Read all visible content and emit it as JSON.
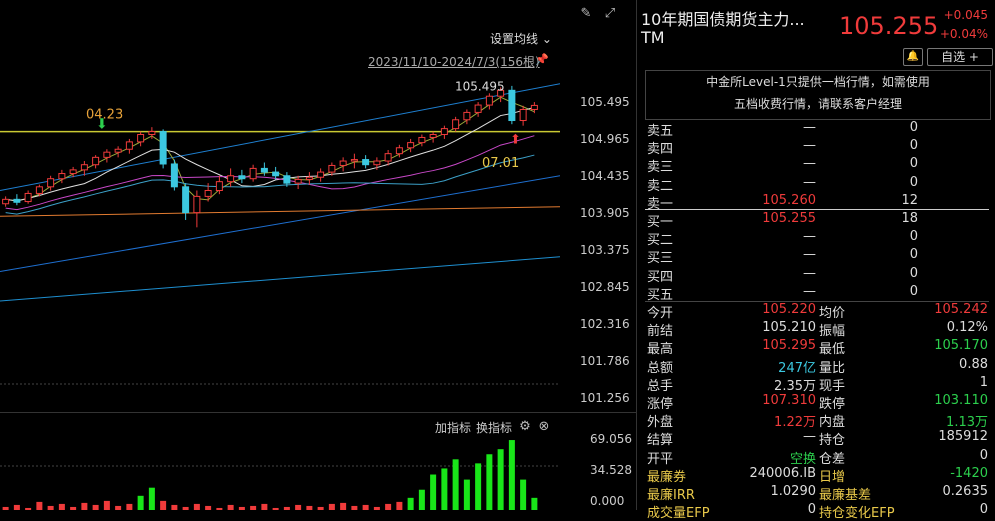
{
  "chart": {
    "ma_setting": "设置均线",
    "range": "2023/11/10-2024/7/3(156根)",
    "price_ticks": [
      "105.495",
      "104.965",
      "104.435",
      "103.905",
      "103.375",
      "102.845",
      "102.316",
      "101.786",
      "101.256"
    ],
    "volume_ticks": [
      "69.056",
      "34.528",
      "0.000"
    ],
    "annotations": {
      "high_label": "105.495",
      "left_label": "04.23",
      "right_label": "07.01"
    },
    "indicator_add": "加指标",
    "indicator_switch": "换指标",
    "colors": {
      "up": "#f03b3b",
      "down": "#3cc8e0",
      "volume": "#19e619"
    }
  },
  "chart_data": {
    "type": "candlestick",
    "series_ohlc": [
      [
        103.92,
        104.02,
        103.88,
        103.98
      ],
      [
        103.98,
        104.05,
        103.9,
        103.94
      ],
      [
        103.95,
        104.1,
        103.92,
        104.06
      ],
      [
        104.06,
        104.18,
        104.02,
        104.15
      ],
      [
        104.15,
        104.3,
        104.1,
        104.26
      ],
      [
        104.26,
        104.38,
        104.2,
        104.33
      ],
      [
        104.33,
        104.42,
        104.28,
        104.38
      ],
      [
        104.38,
        104.5,
        104.3,
        104.45
      ],
      [
        104.45,
        104.58,
        104.4,
        104.55
      ],
      [
        104.55,
        104.66,
        104.48,
        104.62
      ],
      [
        104.62,
        104.7,
        104.55,
        104.66
      ],
      [
        104.66,
        104.8,
        104.6,
        104.76
      ],
      [
        104.76,
        104.9,
        104.7,
        104.86
      ],
      [
        104.86,
        104.96,
        104.8,
        104.9
      ],
      [
        104.9,
        104.93,
        104.4,
        104.46
      ],
      [
        104.46,
        104.52,
        104.1,
        104.15
      ],
      [
        104.15,
        104.2,
        103.7,
        103.8
      ],
      [
        103.8,
        104.1,
        103.6,
        104.02
      ],
      [
        104.02,
        104.2,
        103.95,
        104.1
      ],
      [
        104.1,
        104.3,
        104.05,
        104.22
      ],
      [
        104.22,
        104.4,
        104.15,
        104.3
      ],
      [
        104.3,
        104.38,
        104.2,
        104.26
      ],
      [
        104.26,
        104.45,
        104.22,
        104.4
      ],
      [
        104.4,
        104.48,
        104.3,
        104.35
      ],
      [
        104.35,
        104.42,
        104.25,
        104.3
      ],
      [
        104.3,
        104.35,
        104.15,
        104.2
      ],
      [
        104.2,
        104.3,
        104.12,
        104.25
      ],
      [
        104.25,
        104.35,
        104.18,
        104.28
      ],
      [
        104.28,
        104.4,
        104.22,
        104.35
      ],
      [
        104.35,
        104.48,
        104.3,
        104.44
      ],
      [
        104.44,
        104.55,
        104.36,
        104.5
      ],
      [
        104.5,
        104.6,
        104.4,
        104.52
      ],
      [
        104.52,
        104.58,
        104.4,
        104.45
      ],
      [
        104.45,
        104.55,
        104.38,
        104.5
      ],
      [
        104.5,
        104.65,
        104.44,
        104.6
      ],
      [
        104.6,
        104.72,
        104.55,
        104.68
      ],
      [
        104.68,
        104.8,
        104.62,
        104.75
      ],
      [
        104.75,
        104.86,
        104.7,
        104.82
      ],
      [
        104.82,
        104.9,
        104.75,
        104.86
      ],
      [
        104.86,
        104.98,
        104.8,
        104.94
      ],
      [
        104.94,
        105.1,
        104.9,
        105.06
      ],
      [
        105.06,
        105.2,
        105.0,
        105.16
      ],
      [
        105.16,
        105.3,
        105.1,
        105.26
      ],
      [
        105.26,
        105.42,
        105.2,
        105.38
      ],
      [
        105.38,
        105.5,
        105.3,
        105.46
      ],
      [
        105.46,
        105.52,
        105.0,
        105.05
      ],
      [
        105.05,
        105.25,
        104.98,
        105.2
      ],
      [
        105.2,
        105.3,
        105.15,
        105.255
      ]
    ],
    "volume": [
      3,
      5,
      2,
      8,
      4,
      6,
      3,
      7,
      5,
      9,
      4,
      6,
      14,
      22,
      9,
      5,
      3,
      6,
      4,
      2,
      5,
      3,
      4,
      6,
      2,
      3,
      5,
      4,
      3,
      6,
      7,
      4,
      5,
      3,
      6,
      8,
      12,
      20,
      35,
      41,
      50,
      30,
      46,
      55,
      60,
      69,
      30,
      12
    ],
    "ylim": [
      101.256,
      105.6
    ],
    "volume_ylim": [
      0,
      69.056
    ]
  },
  "quote": {
    "name": "10年期国债期货主力...",
    "code": "TM",
    "last": "105.255",
    "change": "+0.045",
    "change_pct": "+0.04%",
    "watch_label": "自选 +",
    "notice_line1": "中金所Level-1只提供一档行情，如需使用",
    "notice_line2": "五档收费行情，请联系客户经理",
    "book": [
      {
        "label": "卖五",
        "price": "—",
        "vol": "0"
      },
      {
        "label": "卖四",
        "price": "—",
        "vol": "0"
      },
      {
        "label": "卖三",
        "price": "—",
        "vol": "0"
      },
      {
        "label": "卖二",
        "price": "—",
        "vol": "0"
      },
      {
        "label": "卖一",
        "price": "105.260",
        "vol": "12"
      },
      {
        "label": "买一",
        "price": "105.255",
        "vol": "18"
      },
      {
        "label": "买二",
        "price": "—",
        "vol": "0"
      },
      {
        "label": "买三",
        "price": "—",
        "vol": "0"
      },
      {
        "label": "买四",
        "price": "—",
        "vol": "0"
      },
      {
        "label": "买五",
        "price": "—",
        "vol": "0"
      }
    ],
    "stats": [
      {
        "l1": "今开",
        "v1": "105.220",
        "c1": "red",
        "l2": "均价",
        "v2": "105.242",
        "c2": "red"
      },
      {
        "l1": "前结",
        "v1": "105.210",
        "c1": "white",
        "l2": "振幅",
        "v2": "0.12%",
        "c2": "white"
      },
      {
        "l1": "最高",
        "v1": "105.295",
        "c1": "red",
        "l2": "最低",
        "v2": "105.170",
        "c2": "green"
      },
      {
        "l1": "总额",
        "v1": "247亿",
        "c1": "cyan",
        "l2": "量比",
        "v2": "0.88",
        "c2": "white"
      },
      {
        "l1": "总手",
        "v1": "2.35万",
        "c1": "white",
        "l2": "现手",
        "v2": "1",
        "c2": "white"
      },
      {
        "l1": "涨停",
        "v1": "107.310",
        "c1": "red",
        "l2": "跌停",
        "v2": "103.110",
        "c2": "green"
      },
      {
        "l1": "外盘",
        "v1": "1.22万",
        "c1": "red",
        "l2": "内盘",
        "v2": "1.13万",
        "c2": "green"
      },
      {
        "l1": "结算",
        "v1": "—",
        "c1": "white",
        "l2": "持仓",
        "v2": "185912",
        "c2": "white"
      },
      {
        "l1": "开平",
        "v1": "空换",
        "c1": "green",
        "l2": "仓差",
        "v2": "0",
        "c2": "white"
      },
      {
        "l1": "最廉券",
        "v1": "240006.IB",
        "c1": "white",
        "l2": "日增",
        "v2": "-1420",
        "c2": "green"
      },
      {
        "l1": "最廉IRR",
        "v1": "1.0290",
        "c1": "white",
        "l2": "最廉基差",
        "v2": "0.2635",
        "c2": "white"
      },
      {
        "l1": "成交量EFP",
        "v1": "0",
        "c1": "white",
        "l2": "持仓变化EFP",
        "v2": "0",
        "c2": "white"
      }
    ]
  }
}
